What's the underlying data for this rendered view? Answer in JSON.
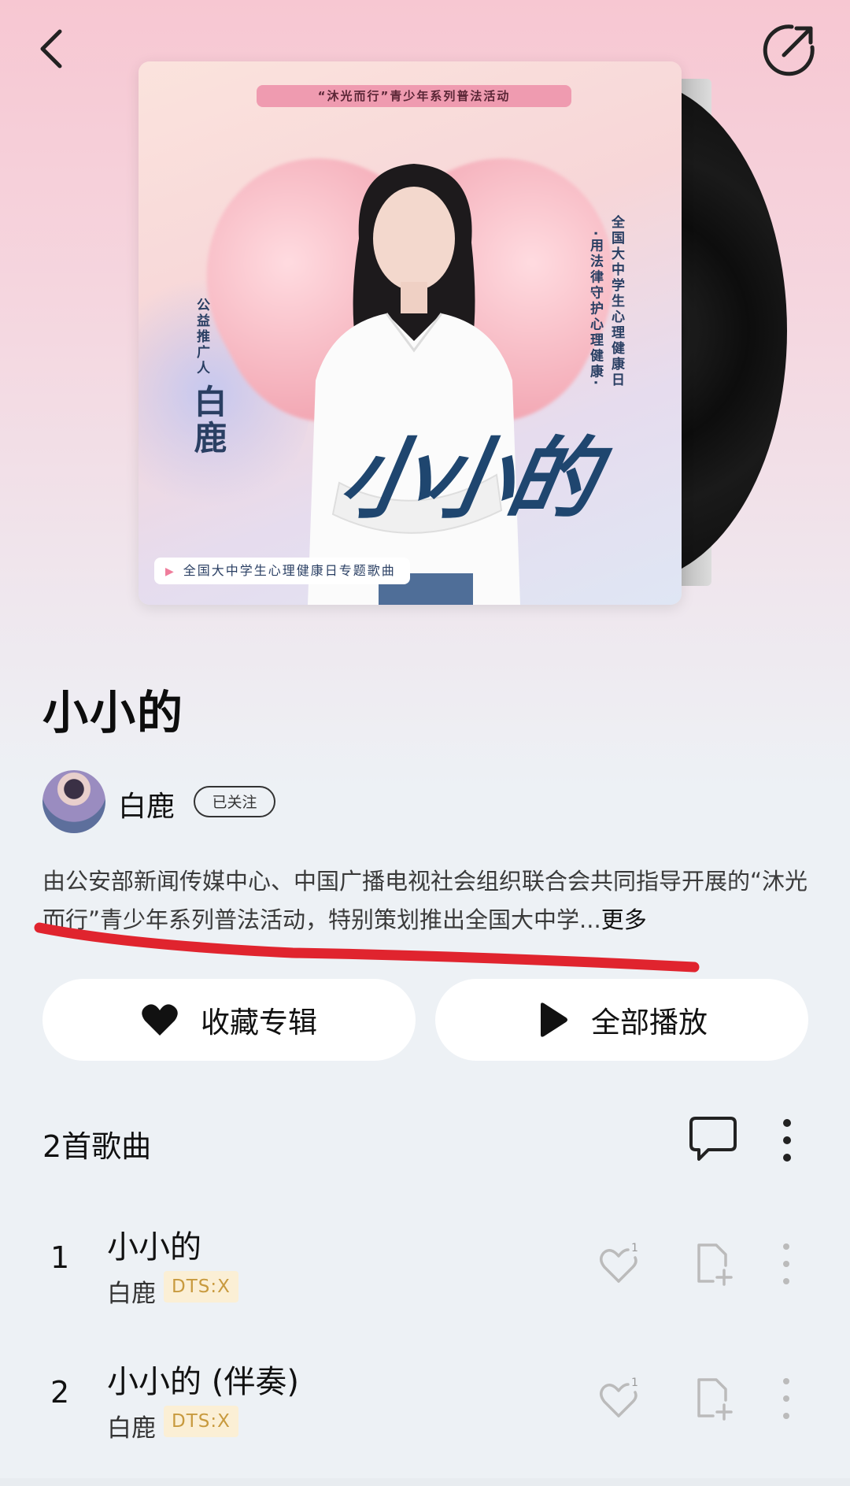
{
  "header": {
    "back_icon": "chevron-left-icon",
    "share_icon": "share-arrow-icon"
  },
  "cover": {
    "banner": "“沐光而行”青少年系列普法活动",
    "promoter_label": "公益推广人",
    "promoter_name": "白鹿",
    "vertical_right_1": "全国大中学生心理健康日",
    "vertical_right_2": "·用法律守护心理健康·",
    "title_art": "小小的",
    "tag": "全国大中学生心理健康日专题歌曲"
  },
  "album": {
    "title": "小小的",
    "artist": "白鹿",
    "follow_label": "已关注",
    "description": "由公安部新闻传媒中心、中国广播电视社会组织联合会共同指导开展的“沐光而行”青少年系列普法活动，特别策划推出全国大中学...",
    "more_label": "更多"
  },
  "actions": {
    "favorite_label": "收藏专辑",
    "play_all_label": "全部播放"
  },
  "list": {
    "count_label": "2首歌曲",
    "songs": [
      {
        "num": "1",
        "title": "小小的",
        "artist": "白鹿",
        "badge": "DTS:X",
        "likes": "1"
      },
      {
        "num": "2",
        "title": "小小的 (伴奏)",
        "artist": "白鹿",
        "badge": "DTS:X",
        "likes": "1"
      }
    ]
  },
  "colors": {
    "accent_annotation": "#e0242e",
    "badge_bg": "#fbefd5",
    "badge_text": "#c89a3e",
    "cover_title": "#1f466f"
  }
}
